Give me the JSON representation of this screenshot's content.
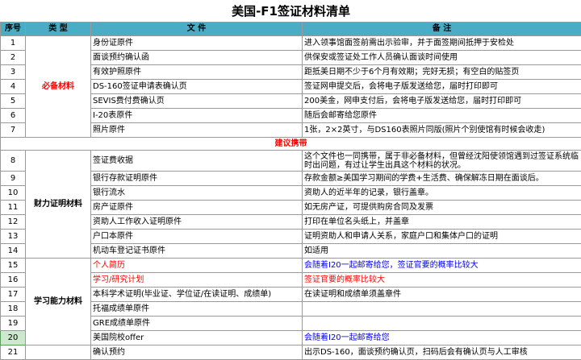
{
  "title": "美国-F1签证材料清单",
  "headers": {
    "no": "序号",
    "type": "类 型",
    "doc": "文 件",
    "note": "备 注"
  },
  "section_must": "必备材料",
  "section_suggest": "建议携带",
  "section_finance": "财力证明材料",
  "section_study": "学习能力材料",
  "rows": [
    {
      "no": "1",
      "doc": "身份证原件",
      "note": "进入领事馆面签前需出示验审，并于面签期间抵押于安检处"
    },
    {
      "no": "2",
      "doc": "面谈预约确认函",
      "note": "供保安或签证处工作人员确认面谈时间使用"
    },
    {
      "no": "3",
      "doc": "有效护照原件",
      "note": "距抵美日期不少于6个月有效期；完好无损；有空白的贴签页"
    },
    {
      "no": "4",
      "doc": "DS-160签证申请表确认页",
      "note": "签证网申提交后，会将电子版发送给您，届时打印即可"
    },
    {
      "no": "5",
      "doc": "SEVIS费付费确认页",
      "note": "200美金，网申支付后，会将电子版发送给您，届时打印即可"
    },
    {
      "no": "6",
      "doc": "I-20表原件",
      "note": "随后会邮寄给您原件"
    },
    {
      "no": "7",
      "doc": "照片原件",
      "note": "1张，2×2英寸，与DS160表照片同版(照片个别使馆有时候会收走)"
    },
    {
      "no": "8",
      "doc": "签证费收据",
      "note": "这个文件也一同携带，属于非必备材料，但曾经沈阳使领馆遇到过签证系统临时出问题，有过让学生出具这个材料的状况。"
    },
    {
      "no": "9",
      "doc": "银行存款证明原件",
      "note": "存款金额≥美国学习期间的学费+生活费、确保解冻日期在面谈后。"
    },
    {
      "no": "10",
      "doc": "银行流水",
      "note": "资助人的近半年的记录，银行盖章。"
    },
    {
      "no": "11",
      "doc": "房产证原件",
      "note": "如无房产证，可提供购房合同及发票"
    },
    {
      "no": "12",
      "doc": "资助人工作收入证明原件",
      "note": "打印在单位名头纸上，并盖章"
    },
    {
      "no": "13",
      "doc": "户口本原件",
      "note": "证明资助人和申请人关系，家庭户口和集体户口的证明"
    },
    {
      "no": "14",
      "doc": "机动车登记证书原件",
      "note": "如适用"
    },
    {
      "no": "15",
      "doc": "个人简历",
      "note": "会随着I20一起邮寄给您，签证官要的概率比较大"
    },
    {
      "no": "16",
      "doc": "学习/研究计划",
      "note": "签证官要的概率比较大"
    },
    {
      "no": "17",
      "doc": "本科学术证明(毕业证、学位证/在读证明、成绩单)",
      "note": "在读证明和成绩单须盖章件"
    },
    {
      "no": "18",
      "doc": "托福成绩单原件",
      "note": ""
    },
    {
      "no": "19",
      "doc": "GRE成绩单原件",
      "note": ""
    },
    {
      "no": "20",
      "doc": "美国院校offer",
      "note": "会随着I20一起邮寄给您"
    },
    {
      "no": "21",
      "doc": "确认预约",
      "note": "出示DS-160，面谈预约确认页，扫码后会有确认页与人工审核"
    }
  ],
  "colors": {
    "header_bg": "#4bacc6",
    "red": "#ff0000",
    "blue": "#0000ff"
  }
}
